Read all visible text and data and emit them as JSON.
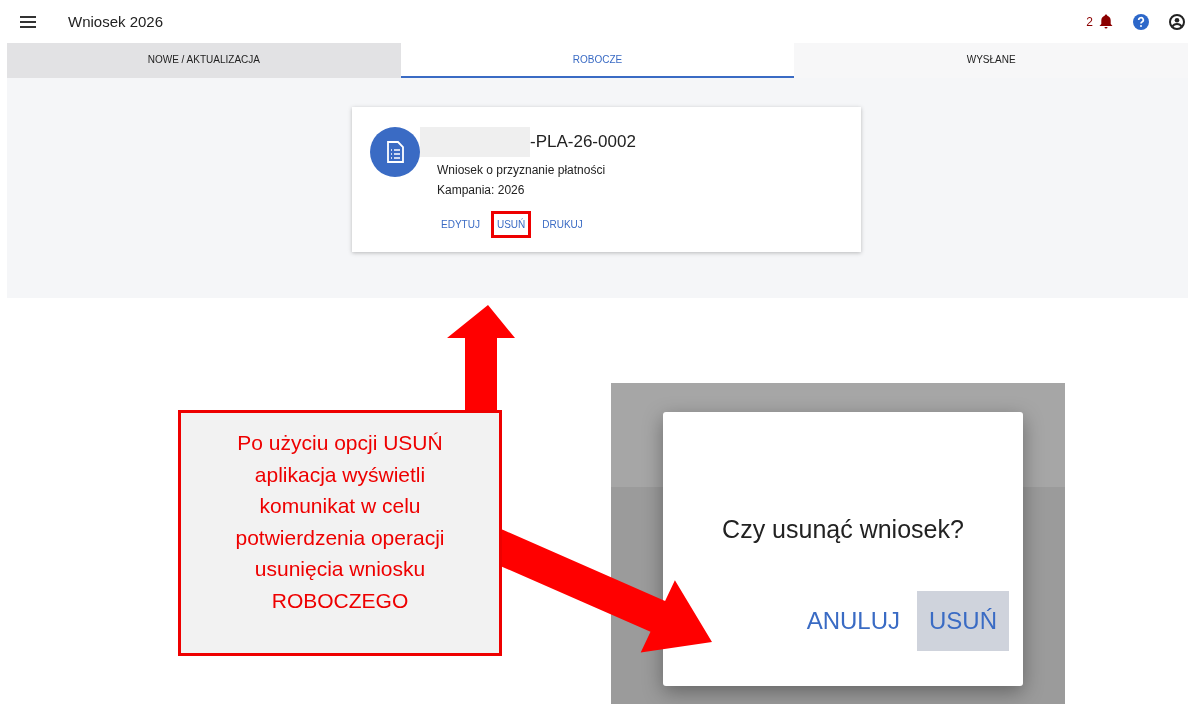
{
  "header": {
    "title": "Wniosek 2026",
    "notification_count": "2"
  },
  "tabs": [
    {
      "label": "NOWE / AKTUALIZACJA",
      "selected": false,
      "hovered": true
    },
    {
      "label": "ROBOCZE",
      "selected": true,
      "hovered": false
    },
    {
      "label": "WYSŁANE",
      "selected": false,
      "hovered": false
    }
  ],
  "card": {
    "number": "-PLA-26-0002",
    "number_redacted": true,
    "description": "Wniosek o przyznanie płatności",
    "campaign": "Kampania: 2026",
    "actions": [
      {
        "label": "EDYTUJ",
        "highlighted": false
      },
      {
        "label": "USUŃ",
        "highlighted": true
      },
      {
        "label": "DRUKUJ",
        "highlighted": false
      }
    ]
  },
  "callout": {
    "text": "Po użyciu opcji USUŃ\naplikacja wyświetli\nkomunikat w celu\npotwierdzenia operacji\nusunięcia wniosku\nROBOCZEGO"
  },
  "dialog_inset": {
    "message": "Czy usunąć wniosek?",
    "buttons": [
      {
        "label": "ANULUJ",
        "kind": "text"
      },
      {
        "label": "USUŃ",
        "kind": "focused"
      }
    ]
  }
}
